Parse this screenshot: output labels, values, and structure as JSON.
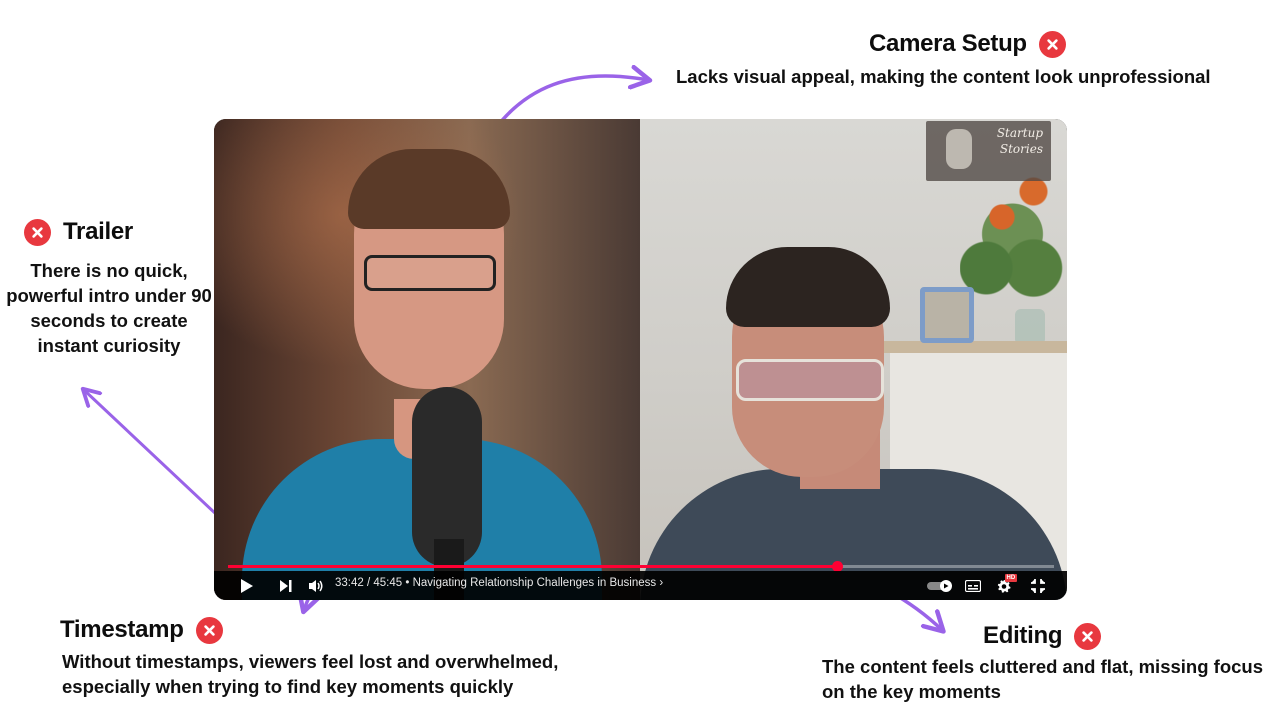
{
  "annotations": {
    "camera_setup": {
      "title": "Camera Setup",
      "description": "Lacks visual appeal, making the content look unprofessional"
    },
    "trailer": {
      "title": "Trailer",
      "description": "There is no quick, powerful intro under 90 seconds to create instant curiosity"
    },
    "timestamp": {
      "title": "Timestamp",
      "description": "Without timestamps, viewers feel lost and overwhelmed, especially when trying to find key moments quickly"
    },
    "editing": {
      "title": "Editing",
      "description": "The content feels cluttered and flat, missing focus on the key moments"
    },
    "badge_icon": "close-x-icon",
    "badge_color": "#e8383f",
    "arrow_color": "#9a63e8"
  },
  "player": {
    "current_time": "33:42",
    "duration": "45:45",
    "separator": " / ",
    "chapter_prefix": " • ",
    "chapter_title": "Navigating Relationship Challenges in Business",
    "chapter_chevron": "›",
    "progress_fraction": 0.737,
    "progress_color": "#ff0033",
    "watermark_line1": "Startup",
    "watermark_line2": "Stories",
    "controls": [
      "play-icon",
      "next-icon",
      "volume-icon",
      "autoplay-toggle",
      "subtitles-icon",
      "settings-gear-icon",
      "exit-fullscreen-icon"
    ],
    "hd_badge": "HD"
  }
}
